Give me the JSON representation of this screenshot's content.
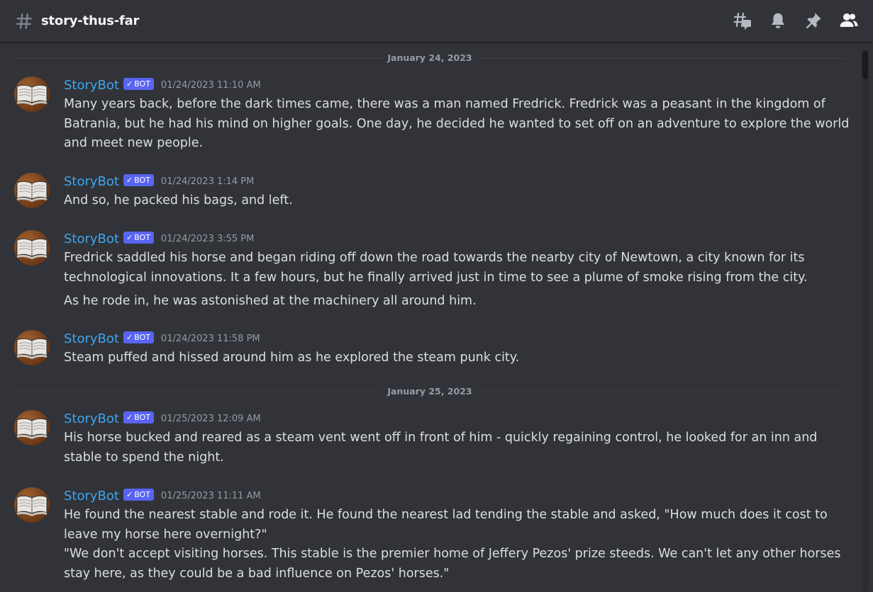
{
  "header": {
    "channel_name": "story-thus-far"
  },
  "dividers": [
    "January 24, 2023",
    "January 25, 2023"
  ],
  "messages": [
    {
      "author": "StoryBot",
      "badge": "BOT",
      "timestamp": "01/24/2023 11:10 AM",
      "lines": [
        "Many years back, before the dark times came, there was a man named Fredrick. Fredrick was a peasant in the kingdom of",
        "Batrania, but he had his mind on higher goals. One day, he decided he wanted to set off on an adventure to explore the world",
        "and meet new people."
      ]
    },
    {
      "author": "StoryBot",
      "badge": "BOT",
      "timestamp": "01/24/2023 1:14 PM",
      "lines": [
        "And so, he packed his bags, and left."
      ]
    },
    {
      "author": "StoryBot",
      "badge": "BOT",
      "timestamp": "01/24/2023 3:55 PM",
      "lines": [
        "Fredrick saddled his horse and began riding off down the road towards the nearby city of Newtown, a city known for its",
        "technological innovations. It a few hours, but he finally arrived just in time to see a plume of smoke rising from the city.",
        "As he rode in, he was astonished at the machinery all around him."
      ]
    },
    {
      "author": "StoryBot",
      "badge": "BOT",
      "timestamp": "01/24/2023 11:58 PM",
      "lines": [
        "Steam puffed and hissed around him as he explored the steam punk city."
      ]
    },
    {
      "author": "StoryBot",
      "badge": "BOT",
      "timestamp": "01/25/2023 12:09 AM",
      "lines": [
        "His horse bucked and reared as a steam vent went off in front of him - quickly regaining control, he looked for an inn and",
        "stable to spend the night."
      ]
    },
    {
      "author": "StoryBot",
      "badge": "BOT",
      "timestamp": "01/25/2023 11:11 AM",
      "lines": [
        "He found the nearest stable and rode it. He found the nearest lad tending the stable and asked, \"How much does it cost to",
        "leave my horse here overnight?\"",
        "\"We don't accept visiting horses. This stable is the premier home of Jeffery Pezos' prize steeds. We can't let any other horses",
        "stay here, as they could be a bad influence on Pezos' horses.\""
      ]
    }
  ],
  "colors": {
    "background": "#313338",
    "author": "#3ea6f0",
    "bot_badge": "#5865f2",
    "text": "#dbdee1",
    "muted": "#949ba4"
  },
  "icons": [
    "hashtag-icon",
    "threads-icon",
    "bell-icon",
    "pin-icon",
    "members-icon",
    "book-avatar-icon"
  ]
}
